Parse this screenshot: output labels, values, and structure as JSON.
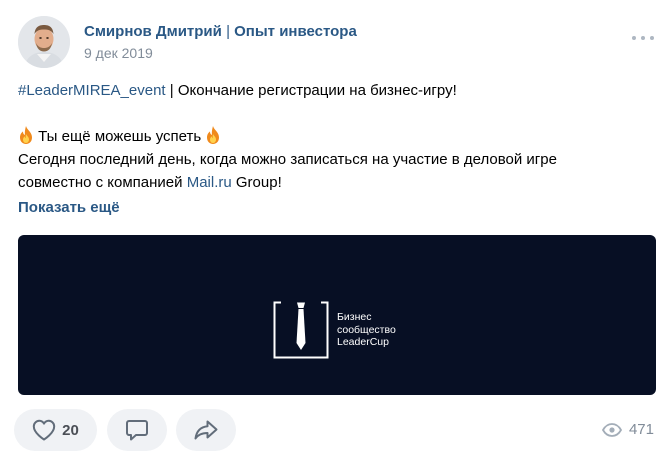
{
  "post": {
    "author_name": "Смирнов Дмитрий",
    "author_separator": "|",
    "author_group": "Опыт инвестора",
    "date": "9 дек 2019",
    "more_icon": "more-dots-icon",
    "hashtag": "#LeaderMIREA_event",
    "headline_rest": " | Окончание регистрации на бизнес-игру!",
    "hint_line": " Ты ещё можешь успеть ",
    "fire_icon": "fire-emoji-icon",
    "body_line1": "Сегодня последний день, когда можно записаться на участие в деловой игре",
    "body_line2_prefix": "совместно с компанией ",
    "link_text": "Mail.ru",
    "body_line2_suffix": " Group!",
    "show_more": "Показать ещё"
  },
  "banner": {
    "background_color": "#070f24",
    "logo_line1": "Бизнес",
    "logo_line2": "сообщество",
    "logo_line3": "LeaderCup"
  },
  "actions": {
    "like_count": "20",
    "views_count": "471",
    "like_icon": "heart-icon",
    "comment_icon": "comment-icon",
    "share_icon": "share-icon",
    "views_icon": "eye-icon"
  },
  "colors": {
    "link": "#2a5885",
    "muted": "#818c99",
    "pill_bg": "#f0f2f5"
  }
}
